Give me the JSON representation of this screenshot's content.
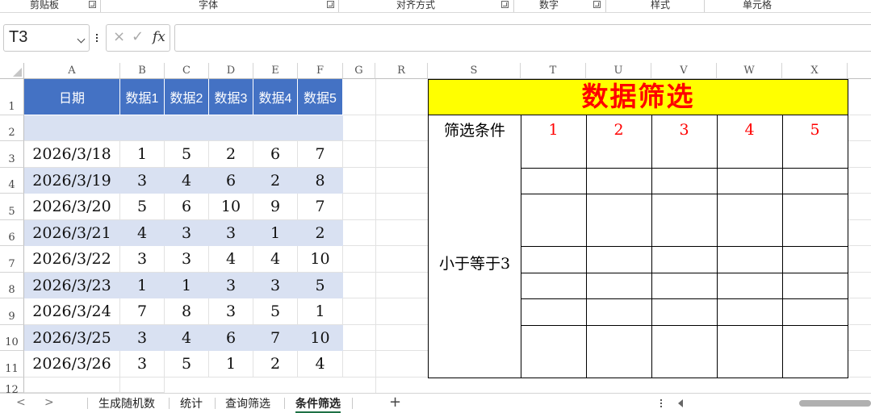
{
  "ribbon": {
    "groups": [
      "剪贴板",
      "字体",
      "对齐方式",
      "数字",
      "样式",
      "单元格"
    ]
  },
  "formula_bar": {
    "name_box": "T3",
    "cancel": "×",
    "enter": "✓",
    "fx": "fx",
    "formula": ""
  },
  "columns": [
    "A",
    "B",
    "C",
    "D",
    "E",
    "F",
    "G",
    "R",
    "S",
    "T",
    "U",
    "V",
    "W",
    "X"
  ],
  "rows": [
    "1",
    "2",
    "3",
    "4",
    "5",
    "6",
    "7",
    "8",
    "9",
    "10",
    "11",
    "12"
  ],
  "table": {
    "headers": [
      "日期",
      "数据1",
      "数据2",
      "数据3",
      "数据4",
      "数据5"
    ],
    "data": [
      [
        "2026/3/18",
        "1",
        "5",
        "2",
        "6",
        "7"
      ],
      [
        "2026/3/19",
        "3",
        "4",
        "6",
        "2",
        "8"
      ],
      [
        "2026/3/20",
        "5",
        "6",
        "10",
        "9",
        "7"
      ],
      [
        "2026/3/21",
        "4",
        "3",
        "3",
        "1",
        "2"
      ],
      [
        "2026/3/22",
        "3",
        "3",
        "4",
        "4",
        "10"
      ],
      [
        "2026/3/23",
        "1",
        "1",
        "3",
        "3",
        "5"
      ],
      [
        "2026/3/24",
        "7",
        "8",
        "3",
        "5",
        "1"
      ],
      [
        "2026/3/25",
        "3",
        "4",
        "6",
        "7",
        "10"
      ],
      [
        "2026/3/26",
        "3",
        "5",
        "1",
        "2",
        "4"
      ]
    ]
  },
  "filter": {
    "title": "数据筛选",
    "condition_label": "筛选条件",
    "numbers": [
      "1",
      "2",
      "3",
      "4",
      "5"
    ],
    "condition": "小于等于3"
  },
  "sheet_tabs": {
    "nav_prev": "<",
    "nav_next": ">",
    "tabs": [
      "生成随机数",
      "统计",
      "查询筛选",
      "条件筛选"
    ],
    "active": "条件筛选",
    "add": "+"
  },
  "colors": {
    "header_blue": "#4472c4",
    "band_blue": "#d9e1f2",
    "title_yellow": "#ffff00",
    "title_red": "#ff0000",
    "active_tab_green": "#1e7145"
  }
}
